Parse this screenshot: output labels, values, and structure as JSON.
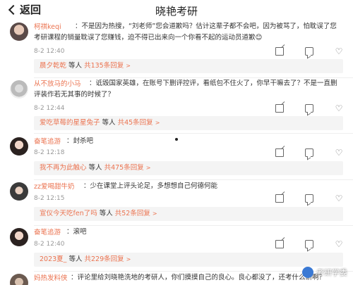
{
  "nav": {
    "back_label": "返回",
    "title": "晓艳考研"
  },
  "comments": [
    {
      "name": "柯祺keqi",
      "text": "：不是因为热搜，“刘老师”您会道歉吗？估计这辈子都不会吧，因为被骂了，怕耽误了您考研课程的销量耽误了您赚钱，迫不得已出来向一个你看不起的运动员道歉",
      "emoji": "😊",
      "time": "8-2 12:40",
      "reply": {
        "user": "晨夕乾乾",
        "middle": " 等人 ",
        "count": "共135条回复"
      }
    },
    {
      "name": "从不放马的小马",
      "text": "：诋毁国家英雄，在账号下删评控评，看纸包不住火了，你早干嘛去了？不是一直删评装作若无其事的时候了？",
      "time": "8-2 12:44",
      "reply": {
        "user": "爱吃草莓的星星兔子",
        "middle": " 等人 ",
        "count": "共45条回复"
      }
    },
    {
      "name": "奋笔追游",
      "text": "：封杀吧",
      "time": "8-2 12:18",
      "reply": {
        "user": "我不再为此触心",
        "middle": " 等人 ",
        "count": "共475条回复"
      }
    },
    {
      "name": "zz爱喝甜牛奶",
      "text": "：少在课堂上评头论足，多想想自己何德何能",
      "time": "8-2 12:15",
      "reply": {
        "user": "宣仪今天吃fen了吗",
        "middle": " 等人 ",
        "count": "共52条回复"
      }
    },
    {
      "name": "奋笔追游",
      "text": "：滚吧",
      "time": "8-2 12:40",
      "reply": {
        "user": "2023夏_",
        "middle": " 等人 ",
        "count": "共229条回复"
      }
    },
    {
      "name": "妈热发料侠",
      "text": "：评论里给刘晓艳洗地的考研人，你们摸摸自己的良心。良心都没了，还考什么研啊？"
    }
  ],
  "icons": {
    "share": "share-icon",
    "comment": "comment-icon",
    "like": "like-icon"
  },
  "watermark": {
    "text": "考研学委"
  },
  "colors": {
    "accent": "#eb7350",
    "reply_bg": "#f4f4f4",
    "muted": "#999999"
  }
}
